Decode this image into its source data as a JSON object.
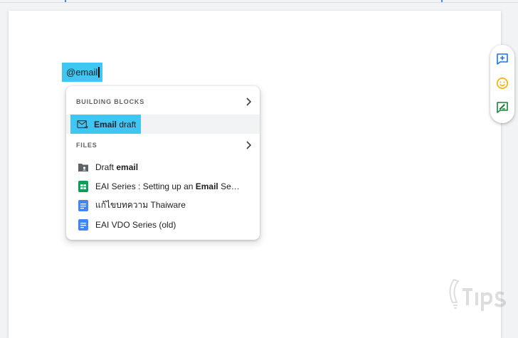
{
  "editor": {
    "mention_text": "@email"
  },
  "menu": {
    "building_blocks": {
      "header": "BUILDING BLOCKS",
      "items": [
        {
          "icon": "email-draft-icon",
          "bold": "Email",
          "rest": " draft"
        }
      ]
    },
    "files": {
      "header": "FILES",
      "items": [
        {
          "icon": "shared-folder-icon",
          "pre": "Draft ",
          "bold": "email",
          "post": ""
        },
        {
          "icon": "google-sheets-icon",
          "pre": "EAI Series : Setting up an ",
          "bold": "Email",
          "post": " Se…"
        },
        {
          "icon": "google-docs-icon",
          "pre": "แก้ไขบทความ Thaiware",
          "bold": "",
          "post": ""
        },
        {
          "icon": "google-docs-icon",
          "pre": "EAI VDO Series (old)",
          "bold": "",
          "post": ""
        }
      ]
    }
  },
  "side_panel": {
    "buttons": [
      "add-comment-icon",
      "emoji-reaction-icon",
      "suggest-edits-icon"
    ]
  },
  "colors": {
    "selection": "#3fc6f2",
    "docs_blue": "#4285f4",
    "sheets_green": "#0f9d58",
    "emoji_yellow": "#f9ab00"
  }
}
